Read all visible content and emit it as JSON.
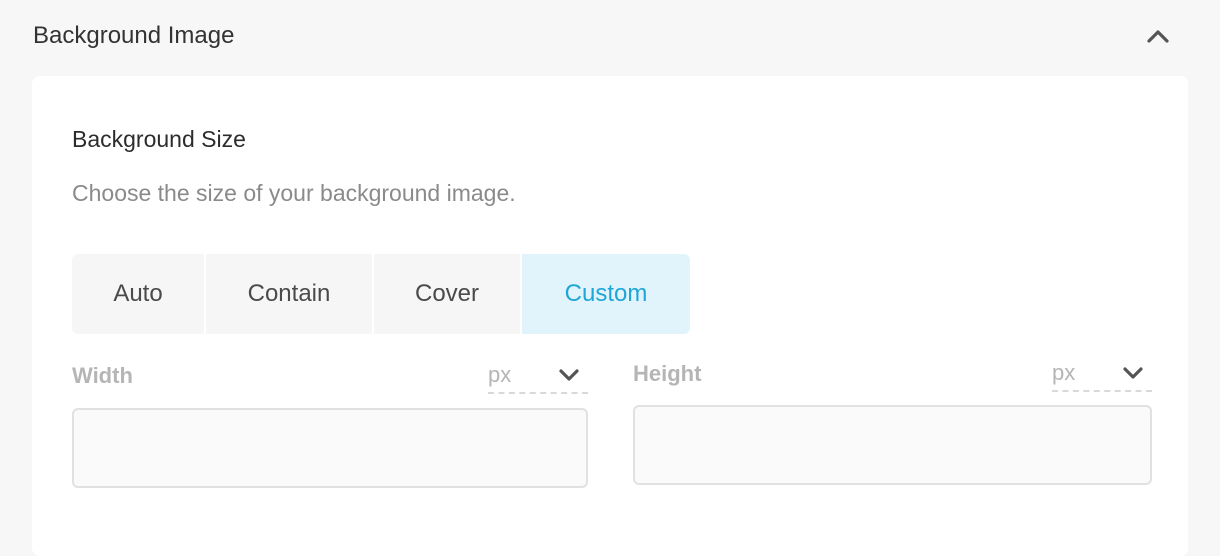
{
  "panel": {
    "title": "Background Image"
  },
  "section": {
    "title": "Background Size",
    "description": "Choose the size of your background image."
  },
  "size_options": [
    {
      "label": "Auto",
      "active": false
    },
    {
      "label": "Contain",
      "active": false
    },
    {
      "label": "Cover",
      "active": false
    },
    {
      "label": "Custom",
      "active": true
    }
  ],
  "width_field": {
    "label": "Width",
    "unit": "px",
    "value": ""
  },
  "height_field": {
    "label": "Height",
    "unit": "px",
    "value": ""
  },
  "icons": {
    "collapse": "chevron-up-icon",
    "unit_dropdown": "chevron-down-icon"
  },
  "colors": {
    "accent": "#1ea6d9",
    "accent_bg": "#e1f4fc",
    "page_bg": "#f7f7f7",
    "card_bg": "#ffffff"
  }
}
